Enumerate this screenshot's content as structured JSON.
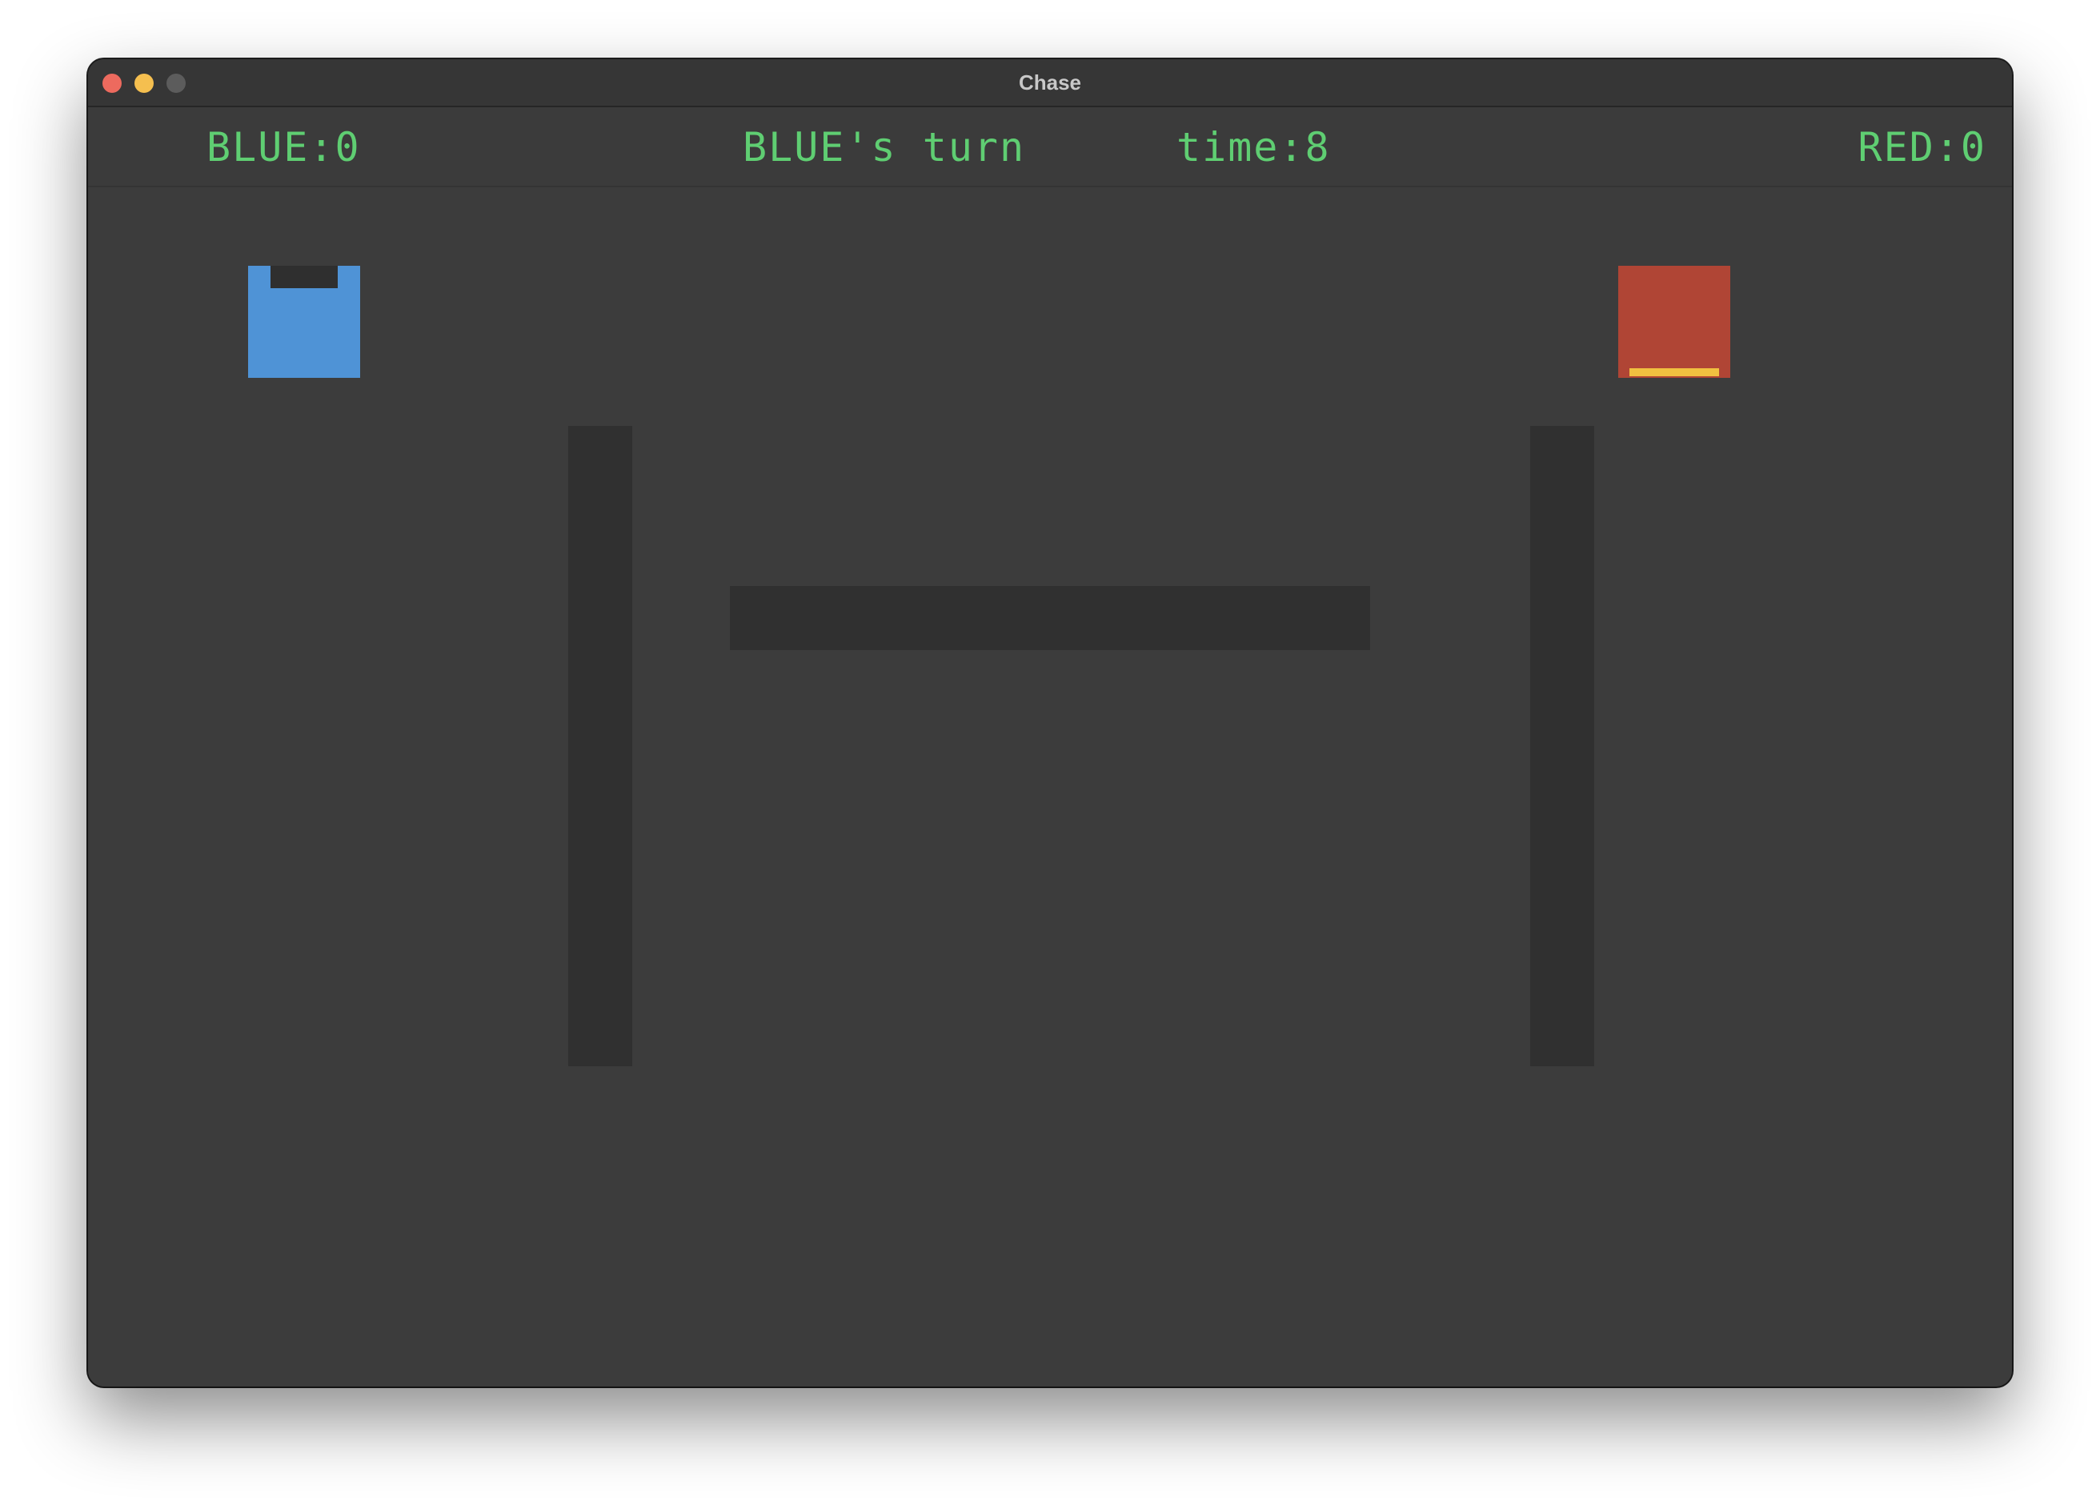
{
  "window": {
    "title": "Chase"
  },
  "hud": {
    "blue_score": "BLUE:0",
    "turn": "BLUE's turn",
    "time": "time:8",
    "red_score": "RED:0"
  },
  "players": {
    "blue": {
      "color": "#4f93d6",
      "facing": "up"
    },
    "red": {
      "color": "#b04535",
      "accent": "#f0c040",
      "facing": "down"
    }
  },
  "colors": {
    "hud_text": "#5fce72",
    "background": "#3c3c3c",
    "wall": "#303030"
  }
}
